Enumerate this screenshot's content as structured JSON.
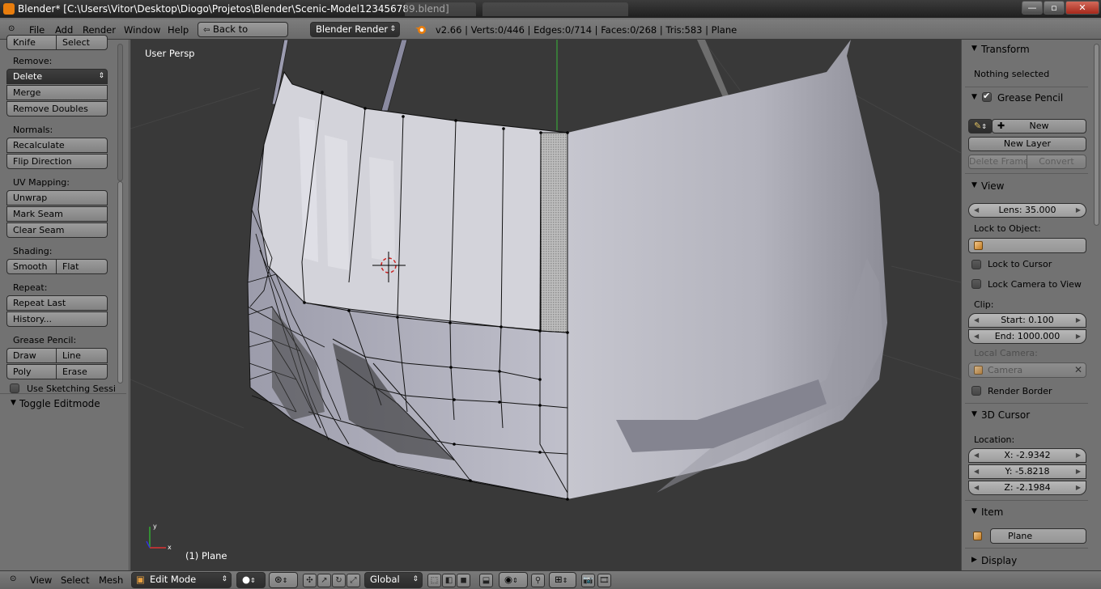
{
  "window": {
    "title": "Blender* [C:\\Users\\Vitor\\Desktop\\Diogo\\Projetos\\Blender\\Scenic-Model123456789.blend]",
    "minimize": "—",
    "maximize": "▫",
    "close": "✕"
  },
  "info_header": {
    "menus": [
      "File",
      "Add",
      "Render",
      "Window",
      "Help"
    ],
    "back_button": "Back to Previous",
    "engine": "Blender Render",
    "stats": "v2.66 | Verts:0/446 | Edges:0/714 | Faces:0/268 | Tris:583 | Plane"
  },
  "toolshelf": {
    "top_buttons": [
      "Knife",
      "Select"
    ],
    "remove_label": "Remove:",
    "delete": "Delete",
    "merge": "Merge",
    "remove_doubles": "Remove Doubles",
    "normals_label": "Normals:",
    "recalculate": "Recalculate",
    "flip_direction": "Flip Direction",
    "uv_label": "UV Mapping:",
    "unwrap": "Unwrap",
    "mark_seam": "Mark Seam",
    "clear_seam": "Clear Seam",
    "shading_label": "Shading:",
    "smooth": "Smooth",
    "flat": "Flat",
    "repeat_label": "Repeat:",
    "repeat_last": "Repeat Last",
    "history": "History...",
    "grease_label": "Grease Pencil:",
    "draw": "Draw",
    "line": "Line",
    "poly": "Poly",
    "erase": "Erase",
    "sketching": "Use Sketching Sessi",
    "toggle_editmode": "Toggle Editmode"
  },
  "viewport": {
    "view_label": "User Persp",
    "object_label": "(1) Plane"
  },
  "properties": {
    "transform_header": "Transform",
    "nothing_selected": "Nothing selected",
    "grease_header": "Grease Pencil",
    "new": "New",
    "new_layer": "New Layer",
    "delete_frame": "Delete Frame",
    "convert": "Convert",
    "view_header": "View",
    "lens": "Lens: 35.000",
    "lock_to_object": "Lock to Object:",
    "lock_to_cursor": "Lock to Cursor",
    "lock_camera": "Lock Camera to View",
    "clip_label": "Clip:",
    "clip_start": "Start: 0.100",
    "clip_end": "End: 1000.000",
    "local_camera": "Local Camera:",
    "camera": "Camera",
    "render_border": "Render Border",
    "cursor_header": "3D Cursor",
    "location_label": "Location:",
    "x": "X: -2.9342",
    "y": "Y: -5.8218",
    "z": "Z: -2.1984",
    "item_header": "Item",
    "item_name": "Plane",
    "display_header": "Display"
  },
  "view_header": {
    "menus": [
      "View",
      "Select",
      "Mesh"
    ],
    "mode": "Edit Mode",
    "orientation": "Global"
  }
}
